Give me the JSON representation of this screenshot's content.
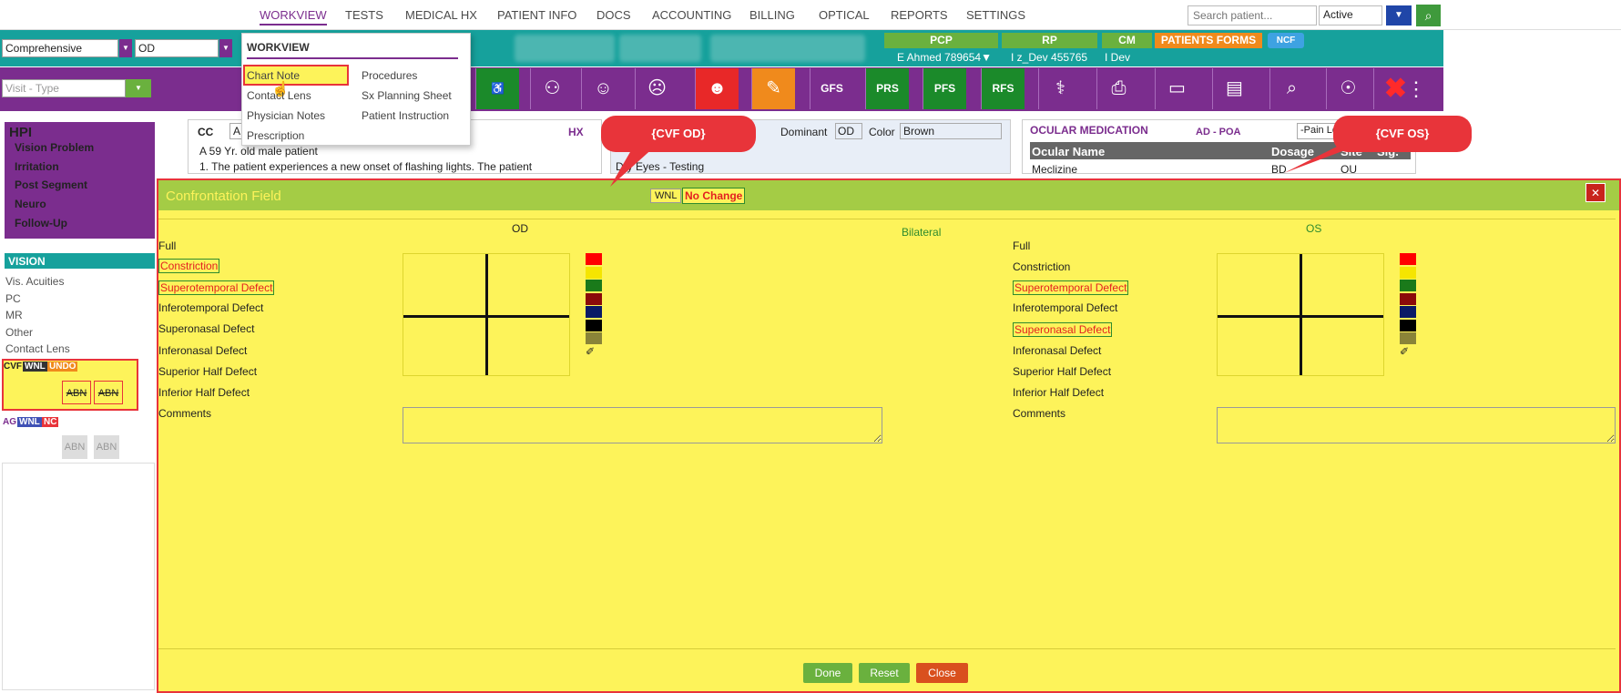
{
  "nav": {
    "items": [
      "WORKVIEW",
      "TESTS",
      "MEDICAL HX",
      "PATIENT INFO",
      "DOCS",
      "ACCOUNTING",
      "BILLING",
      "OPTICAL",
      "REPORTS",
      "SETTINGS"
    ],
    "search_placeholder": "Search patient...",
    "status_value": "Active"
  },
  "visit": {
    "exam_type": "Comprehensive",
    "eye": "OD",
    "visit_type_placeholder": "Visit - Type"
  },
  "providers": {
    "pcp_label": "PCP",
    "pcp_value": "E Ahmed 789654▼",
    "rp_label": "RP",
    "rp_value": "I z_Dev 455765",
    "cm_label": "CM",
    "cm_value": "I Dev",
    "forms_label": "PATIENTS FORMS",
    "ncf_label": "NCF"
  },
  "toolbar": {
    "gfs": "GFS",
    "prs": "PRS",
    "pfs": "PFS",
    "rfs": "RFS"
  },
  "menu": {
    "title": "WORKVIEW",
    "col1": [
      "Chart Note",
      "Contact Lens",
      "Physician Notes",
      "Prescription"
    ],
    "col2": [
      "Procedures",
      "Sx Planning Sheet",
      "Patient Instruction"
    ]
  },
  "sidebar": {
    "hpi_title": "HPI",
    "hpi_items": [
      "Vision Problem",
      "Irritation",
      "Post Segment",
      "Neuro",
      "Follow-Up"
    ],
    "vision_title": "VISION",
    "vision_items": [
      "Vis. Acuities",
      "PC",
      "MR",
      "Other",
      "Contact Lens"
    ],
    "cvf_label": "CVF",
    "cvf_wnl": "WNL",
    "cvf_undo": "UNDO",
    "abn": "ABN",
    "ag_label": "AG",
    "ag_wnl": "WNL",
    "ag_nc": "NC"
  },
  "cc": {
    "label": "CC",
    "value": "A",
    "hx": "HX",
    "text_line1": "A 59 Yr. old male patient",
    "text_line2": "1. The patient experiences a new onset of flashing lights.  The patient",
    "hx_text": "Dry Eyes - Testing",
    "dominant_label": "Dominant",
    "dominant_value": "OD",
    "color_label": "Color",
    "color_value": "Brown"
  },
  "ocular": {
    "title": "OCULAR MEDICATION",
    "ad_poa": "AD - POA",
    "pain": "-Pain Level-",
    "columns": [
      "Ocular Name",
      "Dosage",
      "Site",
      "Sig."
    ],
    "row": [
      "Meclizine",
      "BD",
      "OU",
      ""
    ]
  },
  "callouts": {
    "od": "{CVF OD}",
    "os": "{CVF OS}"
  },
  "modal": {
    "title": "Confrontation Field",
    "wnl": "WNL",
    "no_change": "No Change",
    "close_x": "✕",
    "od_label": "OD",
    "os_label": "OS",
    "bilateral": "Bilateral",
    "od_items": [
      "Full",
      "Constriction",
      "Superotemporal Defect",
      "Inferotemporal Defect",
      "Superonasal Defect",
      "Inferonasal Defect",
      "Superior Half Defect",
      "Inferior Half Defect",
      "Comments"
    ],
    "os_items": [
      "Full",
      "Constriction",
      "Superotemporal Defect",
      "Inferotemporal Defect",
      "Superonasal Defect",
      "Inferonasal Defect",
      "Superior Half Defect",
      "Inferior Half Defect",
      "Comments"
    ],
    "done": "Done",
    "reset": "Reset",
    "close": "Close",
    "swatch_colors": [
      "#ff0000",
      "#f5e500",
      "#1a7a1a",
      "#8b0a0a",
      "#0a1a66",
      "#000000",
      "#8a8438"
    ]
  }
}
